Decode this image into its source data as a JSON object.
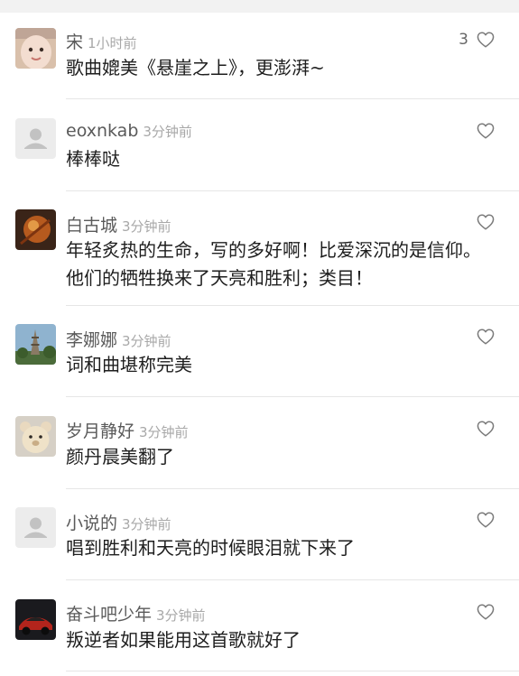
{
  "comments": [
    {
      "name": "宋",
      "time": "1小时前",
      "text": "歌曲媲美《悬崖之上》，更澎湃~",
      "likes": "3",
      "avatar": "baby-photo-avatar"
    },
    {
      "name": "eoxnkab",
      "time": "3分钟前",
      "text": "棒棒哒",
      "likes": "",
      "avatar": "default-user-avatar"
    },
    {
      "name": "白古城",
      "time": "3分钟前",
      "text": "年轻炙热的生命，写的多好啊！比爱深沉的是信仰。他们的牺牲换来了天亮和胜利；类目！",
      "likes": "",
      "avatar": "orange-object-avatar"
    },
    {
      "name": "李娜娜",
      "time": "3分钟前",
      "text": "词和曲堪称完美",
      "likes": "",
      "avatar": "pagoda-photo-avatar"
    },
    {
      "name": "岁月静好",
      "time": "3分钟前",
      "text": "颜丹晨美翻了",
      "likes": "",
      "avatar": "teddy-bear-avatar"
    },
    {
      "name": "小说的",
      "time": "3分钟前",
      "text": "唱到胜利和天亮的时候眼泪就下来了",
      "likes": "",
      "avatar": "default-user-avatar"
    },
    {
      "name": "奋斗吧少年",
      "time": "3分钟前",
      "text": "叛逆者如果能用这首歌就好了",
      "likes": "",
      "avatar": "sports-car-avatar"
    }
  ],
  "icons": {
    "like": "heart-outline-icon"
  },
  "colors": {
    "name": "#5a5a5a",
    "time": "#a8a8a8",
    "text": "#1e1e1e",
    "divider": "#e6e6e6"
  }
}
